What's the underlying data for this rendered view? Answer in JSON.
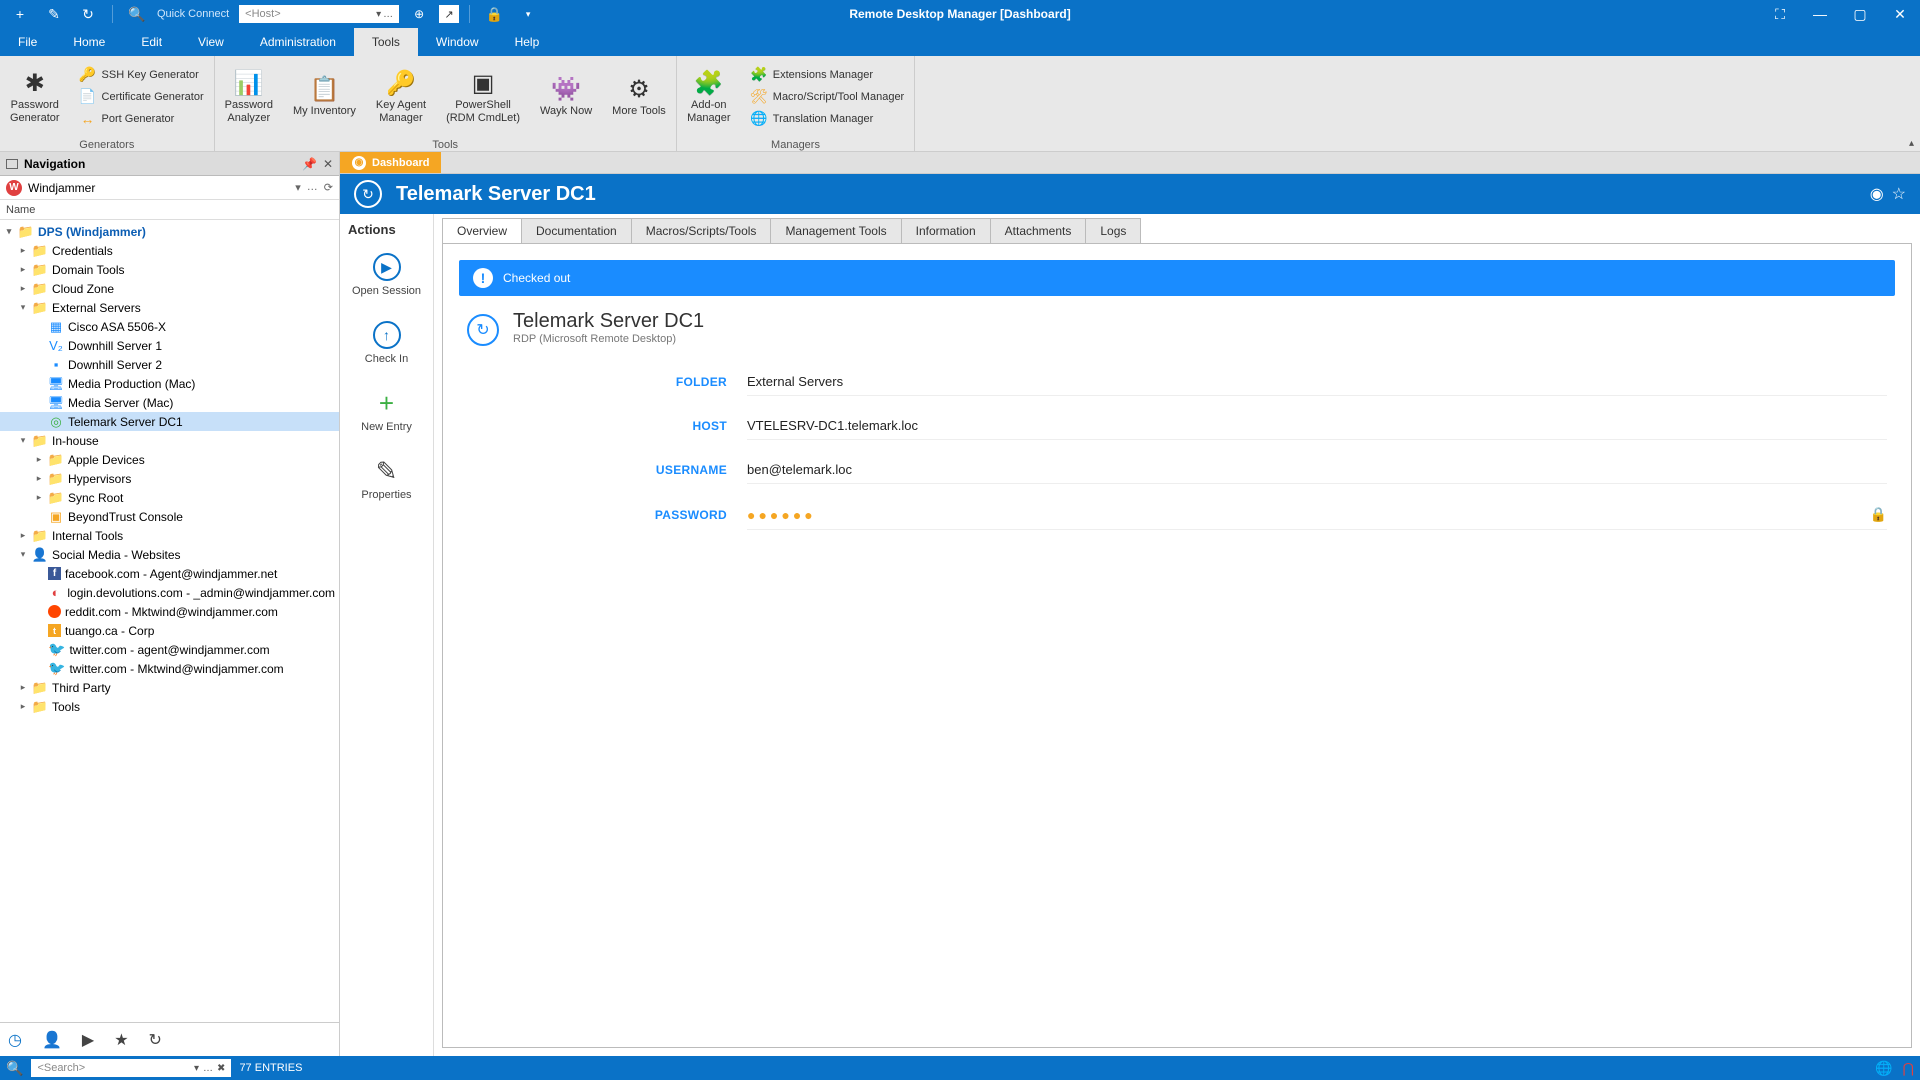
{
  "title": "Remote Desktop Manager [Dashboard]",
  "quickConnect": {
    "label": "Quick Connect",
    "placeholder": "<Host>"
  },
  "menus": [
    "File",
    "Home",
    "Edit",
    "View",
    "Administration",
    "Tools",
    "Window",
    "Help"
  ],
  "menuActiveIndex": 5,
  "ribbon": {
    "groups": [
      {
        "title": "Generators",
        "large": [
          {
            "label": "Password\nGenerator",
            "icon": "✱"
          }
        ],
        "small": [
          {
            "label": "SSH Key Generator",
            "icon": "🔑",
            "cls": "ic-green"
          },
          {
            "label": "Certificate Generator",
            "icon": "📄",
            "cls": "ic-gray"
          },
          {
            "label": "Port Generator",
            "icon": "↔",
            "cls": "ic-orange"
          }
        ]
      },
      {
        "title": "Tools",
        "large": [
          {
            "label": "Password\nAnalyzer",
            "icon": "📊"
          },
          {
            "label": "My Inventory",
            "icon": "📋"
          },
          {
            "label": "Key Agent\nManager",
            "icon": "🔑"
          },
          {
            "label": "PowerShell\n(RDM CmdLet)",
            "icon": "▣"
          },
          {
            "label": "Wayk Now",
            "icon": "👾"
          },
          {
            "label": "More Tools",
            "icon": "⚙"
          }
        ]
      },
      {
        "title": "Managers",
        "large": [
          {
            "label": "Add-on\nManager",
            "icon": "🧩"
          }
        ],
        "small": [
          {
            "label": "Extensions Manager",
            "icon": "🧩",
            "cls": "ic-green"
          },
          {
            "label": "Macro/Script/Tool Manager",
            "icon": "🛠",
            "cls": "ic-orange"
          },
          {
            "label": "Translation Manager",
            "icon": "🌐",
            "cls": "ic-blue"
          }
        ]
      }
    ]
  },
  "navigation": {
    "title": "Navigation",
    "datasource": "Windjammer",
    "column": "Name",
    "tree": [
      {
        "depth": 0,
        "exp": "▾",
        "icon": "📁",
        "label": "DPS (Windjammer)",
        "cls": "root folder-ic"
      },
      {
        "depth": 1,
        "exp": "▸",
        "icon": "📁",
        "label": "Credentials",
        "cls": "folder-ic"
      },
      {
        "depth": 1,
        "exp": "▸",
        "icon": "📁",
        "label": "Domain Tools",
        "cls": "folder-ic"
      },
      {
        "depth": 1,
        "exp": "▸",
        "icon": "📁",
        "label": "Cloud Zone",
        "cls": "folder-ic"
      },
      {
        "depth": 1,
        "exp": "▾",
        "icon": "📁",
        "label": "External Servers",
        "cls": "folder-ic"
      },
      {
        "depth": 2,
        "exp": "",
        "icon": "▦",
        "label": "Cisco ASA 5506-X",
        "cls": "ic-blue"
      },
      {
        "depth": 2,
        "exp": "",
        "icon": "V₂",
        "label": "Downhill Server 1",
        "cls": "ic-blue"
      },
      {
        "depth": 2,
        "exp": "",
        "icon": "▪",
        "label": "Downhill Server 2",
        "cls": "ic-blue"
      },
      {
        "depth": 2,
        "exp": "",
        "icon": "🖥",
        "label": "Media Production (Mac)",
        "cls": "ic-blue"
      },
      {
        "depth": 2,
        "exp": "",
        "icon": "🖥",
        "label": "Media Server (Mac)",
        "cls": "ic-blue"
      },
      {
        "depth": 2,
        "exp": "",
        "icon": "◎",
        "label": "Telemark Server DC1",
        "cls": "ic-green",
        "selected": true
      },
      {
        "depth": 1,
        "exp": "▾",
        "icon": "📁",
        "label": "In-house",
        "cls": "folder-ic"
      },
      {
        "depth": 2,
        "exp": "▸",
        "icon": "📁",
        "label": "Apple Devices",
        "cls": "folder-ic"
      },
      {
        "depth": 2,
        "exp": "▸",
        "icon": "📁",
        "label": "Hypervisors",
        "cls": "folder-ic"
      },
      {
        "depth": 2,
        "exp": "▸",
        "icon": "📁",
        "label": "Sync Root",
        "cls": "folder-ic"
      },
      {
        "depth": 2,
        "exp": "",
        "icon": "▣",
        "label": "BeyondTrust Console",
        "cls": "ic-orange"
      },
      {
        "depth": 1,
        "exp": "▸",
        "icon": "📁",
        "label": "Internal Tools",
        "cls": "folder-ic"
      },
      {
        "depth": 1,
        "exp": "▾",
        "icon": "👤",
        "label": "Social Media - Websites",
        "cls": "ic-orange"
      },
      {
        "depth": 2,
        "exp": "",
        "iconType": "fb",
        "label": "facebook.com - Agent@windjammer.net"
      },
      {
        "depth": 2,
        "exp": "",
        "icon": "◐",
        "label": "login.devolutions.com - _admin@windjammer.com",
        "cls": "ic-red"
      },
      {
        "depth": 2,
        "exp": "",
        "iconType": "rd",
        "label": "reddit.com - Mktwind@windjammer.com"
      },
      {
        "depth": 2,
        "exp": "",
        "iconType": "tu",
        "label": "tuango.ca - Corp"
      },
      {
        "depth": 2,
        "exp": "",
        "iconType": "tw",
        "label": "twitter.com - agent@windjammer.com"
      },
      {
        "depth": 2,
        "exp": "",
        "iconType": "tw",
        "label": "twitter.com - Mktwind@windjammer.com"
      },
      {
        "depth": 1,
        "exp": "▸",
        "icon": "📁",
        "label": "Third Party",
        "cls": "folder-ic"
      },
      {
        "depth": 1,
        "exp": "▸",
        "icon": "📁",
        "label": "Tools",
        "cls": "folder-ic"
      }
    ]
  },
  "docTab": "Dashboard",
  "header": {
    "title": "Telemark Server DC1"
  },
  "actions": {
    "title": "Actions",
    "items": [
      {
        "label": "Open Session",
        "icon": "▶"
      },
      {
        "label": "Check In",
        "icon": "↑"
      },
      {
        "label": "New Entry",
        "icon": "+",
        "color": "#3cb043",
        "noCircle": true
      },
      {
        "label": "Properties",
        "icon": "✎",
        "noCircle": true
      }
    ]
  },
  "subtabs": [
    "Overview",
    "Documentation",
    "Macros/Scripts/Tools",
    "Management Tools",
    "Information",
    "Attachments",
    "Logs"
  ],
  "subtabActive": 0,
  "banner": "Checked out",
  "server": {
    "name": "Telemark Server DC1",
    "sub": "RDP (Microsoft Remote Desktop)",
    "fields": [
      {
        "key": "FOLDER",
        "value": "External Servers"
      },
      {
        "key": "HOST",
        "value": "VTELESRV-DC1.telemark.loc"
      },
      {
        "key": "USERNAME",
        "value": "ben@telemark.loc"
      },
      {
        "key": "PASSWORD",
        "value": "",
        "password": true
      }
    ]
  },
  "statusbar": {
    "searchPlaceholder": "<Search>",
    "entries": "77 ENTRIES"
  }
}
